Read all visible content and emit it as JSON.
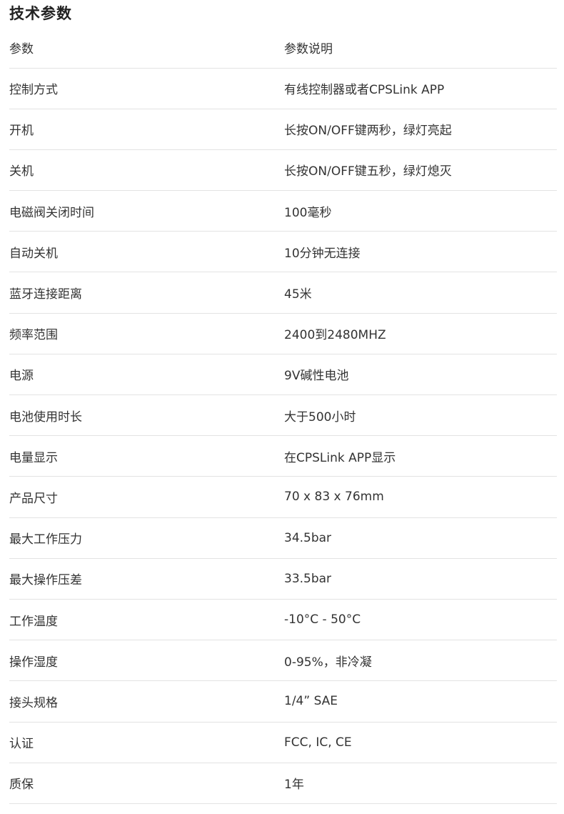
{
  "section": {
    "title": "技术参数"
  },
  "table": {
    "headers": {
      "param": "参数",
      "desc": "参数说明"
    },
    "rows": [
      {
        "param": "控制方式",
        "desc": "有线控制器或者CPSLink APP"
      },
      {
        "param": "开机",
        "desc": "长按ON/OFF键两秒，绿灯亮起"
      },
      {
        "param": "关机",
        "desc": "长按ON/OFF键五秒，绿灯熄灭"
      },
      {
        "param": "电磁阀关闭时间",
        "desc": "100毫秒"
      },
      {
        "param": "自动关机",
        "desc": "10分钟无连接"
      },
      {
        "param": "蓝牙连接距离",
        "desc": "45米"
      },
      {
        "param": "频率范围",
        "desc": "2400到2480MHZ"
      },
      {
        "param": "电源",
        "desc": "9V碱性电池"
      },
      {
        "param": "电池使用时长",
        "desc": "大于500小时"
      },
      {
        "param": "电量显示",
        "desc": "在CPSLink APP显示"
      },
      {
        "param": "产品尺寸",
        "desc": "70 x 83 x 76mm"
      },
      {
        "param": "最大工作压力",
        "desc": "34.5bar"
      },
      {
        "param": "最大操作压差",
        "desc": "33.5bar"
      },
      {
        "param": "工作温度",
        "desc": "-10°C - 50°C"
      },
      {
        "param": "操作湿度",
        "desc": "0-95%，非冷凝"
      },
      {
        "param": "接头规格",
        "desc": "1/4”  SAE"
      },
      {
        "param": "认证",
        "desc": "FCC, IC, CE"
      },
      {
        "param": "质保",
        "desc": "1年"
      }
    ]
  }
}
